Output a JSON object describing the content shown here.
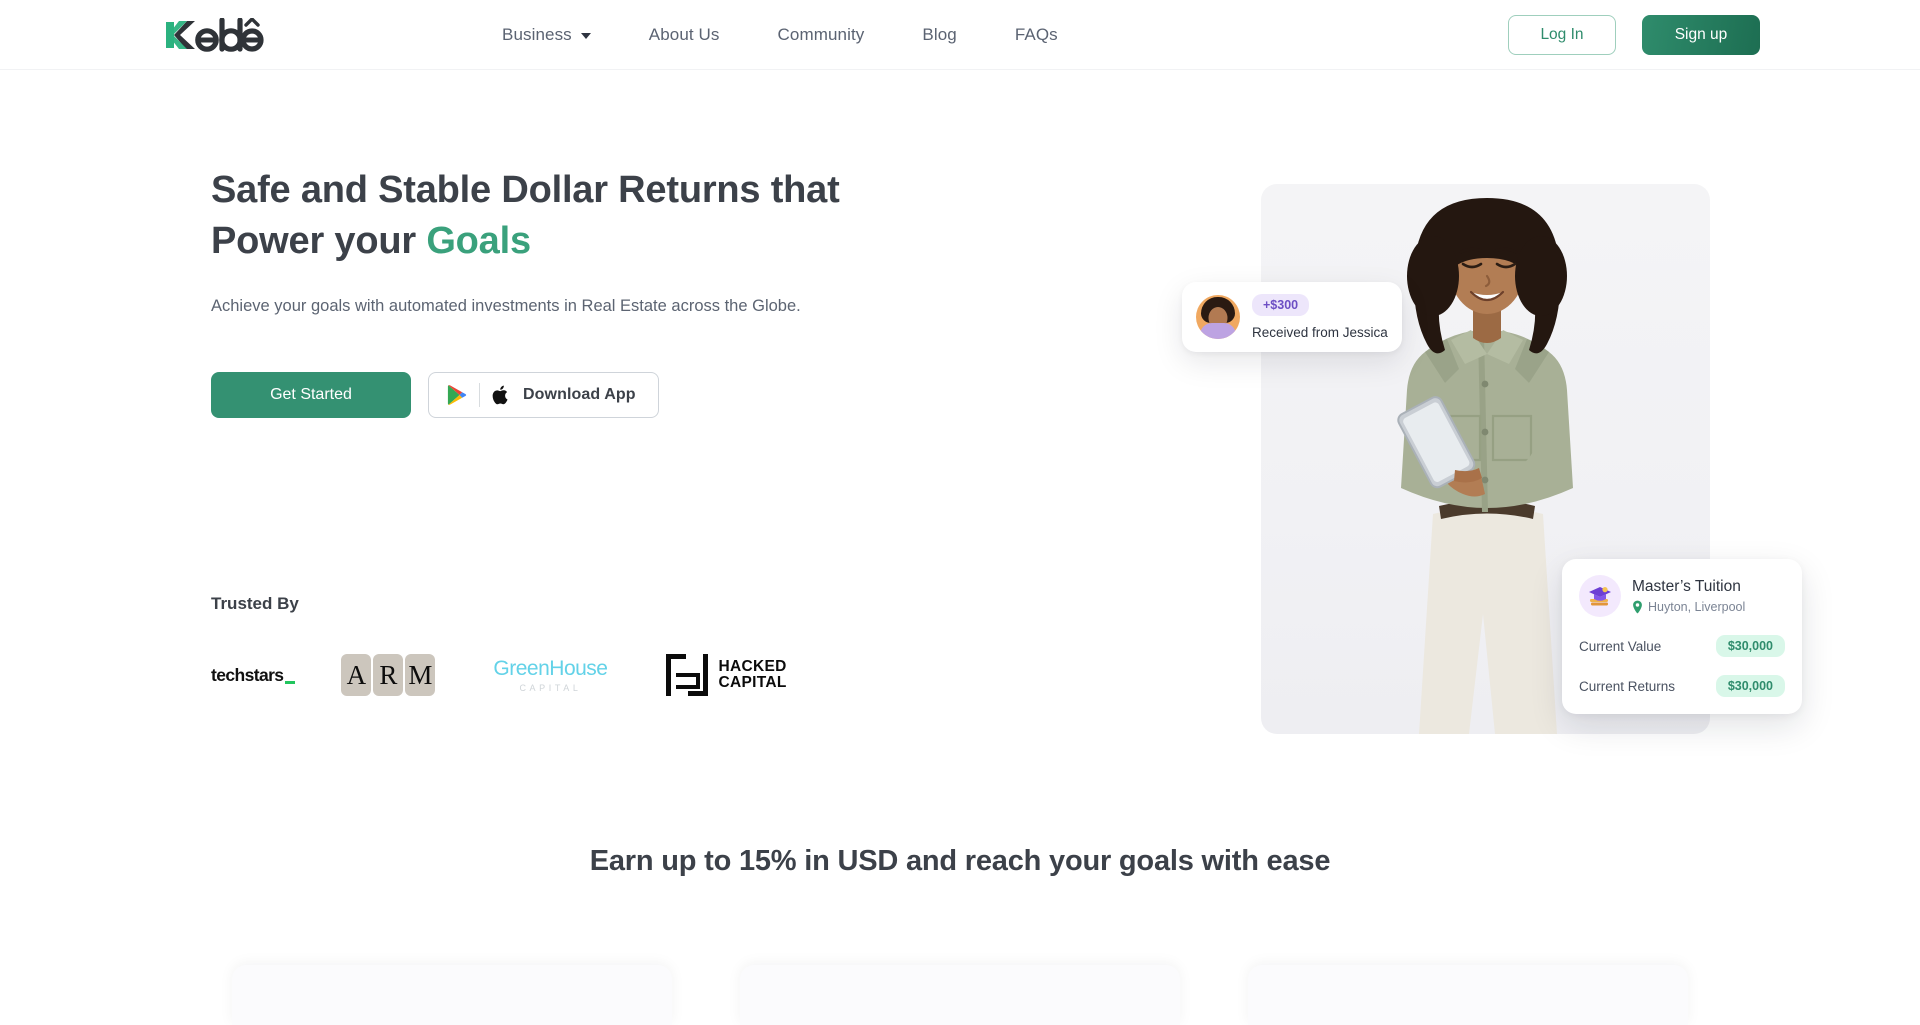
{
  "brand": {
    "name": "Keblê",
    "logo_k": "K",
    "logo_rest": "eblê",
    "accent_green": "#349172",
    "accent_green_light": "#3aa17c"
  },
  "header": {
    "nav": [
      {
        "label": "Business",
        "has_dropdown": true
      },
      {
        "label": "About Us",
        "has_dropdown": false
      },
      {
        "label": "Community",
        "has_dropdown": false
      },
      {
        "label": "Blog",
        "has_dropdown": false
      },
      {
        "label": "FAQs",
        "has_dropdown": false
      }
    ],
    "login_label": "Log In",
    "signup_label": "Sign up"
  },
  "hero": {
    "headline_part1": "Safe and Stable Dollar Returns that Power your ",
    "headline_accent": "Goals",
    "subtitle": "Achieve your goals with automated investments in Real Estate across the Globe.",
    "cta_primary": "Get Started",
    "cta_secondary": "Download App",
    "store_icons": [
      "google-play-icon",
      "apple-icon"
    ]
  },
  "trusted": {
    "title": "Trusted By",
    "logos": [
      {
        "name": "techstars",
        "text": "techstars"
      },
      {
        "name": "arm",
        "letters": [
          "A",
          "R",
          "M"
        ]
      },
      {
        "name": "greenhouse-capital",
        "main": "GreenHouse",
        "sub": "CAPITAL"
      },
      {
        "name": "hacked-capital",
        "line1": "HACKED",
        "line2": "CAPITAL"
      }
    ]
  },
  "notification": {
    "amount": "+$300",
    "text": "Received from Jessica",
    "avatar": "woman-avatar"
  },
  "investment_card": {
    "title": "Master’s Tuition",
    "location": "Huyton, Liverpool",
    "icon": "graduation-cap-icon",
    "location_icon": "location-pin-icon",
    "rows": [
      {
        "label": "Current Value",
        "value": "$30,000"
      },
      {
        "label": "Current Returns",
        "value": "$30,000"
      }
    ]
  },
  "section": {
    "heading": "Earn up to 15% in USD and reach your goals with ease"
  }
}
